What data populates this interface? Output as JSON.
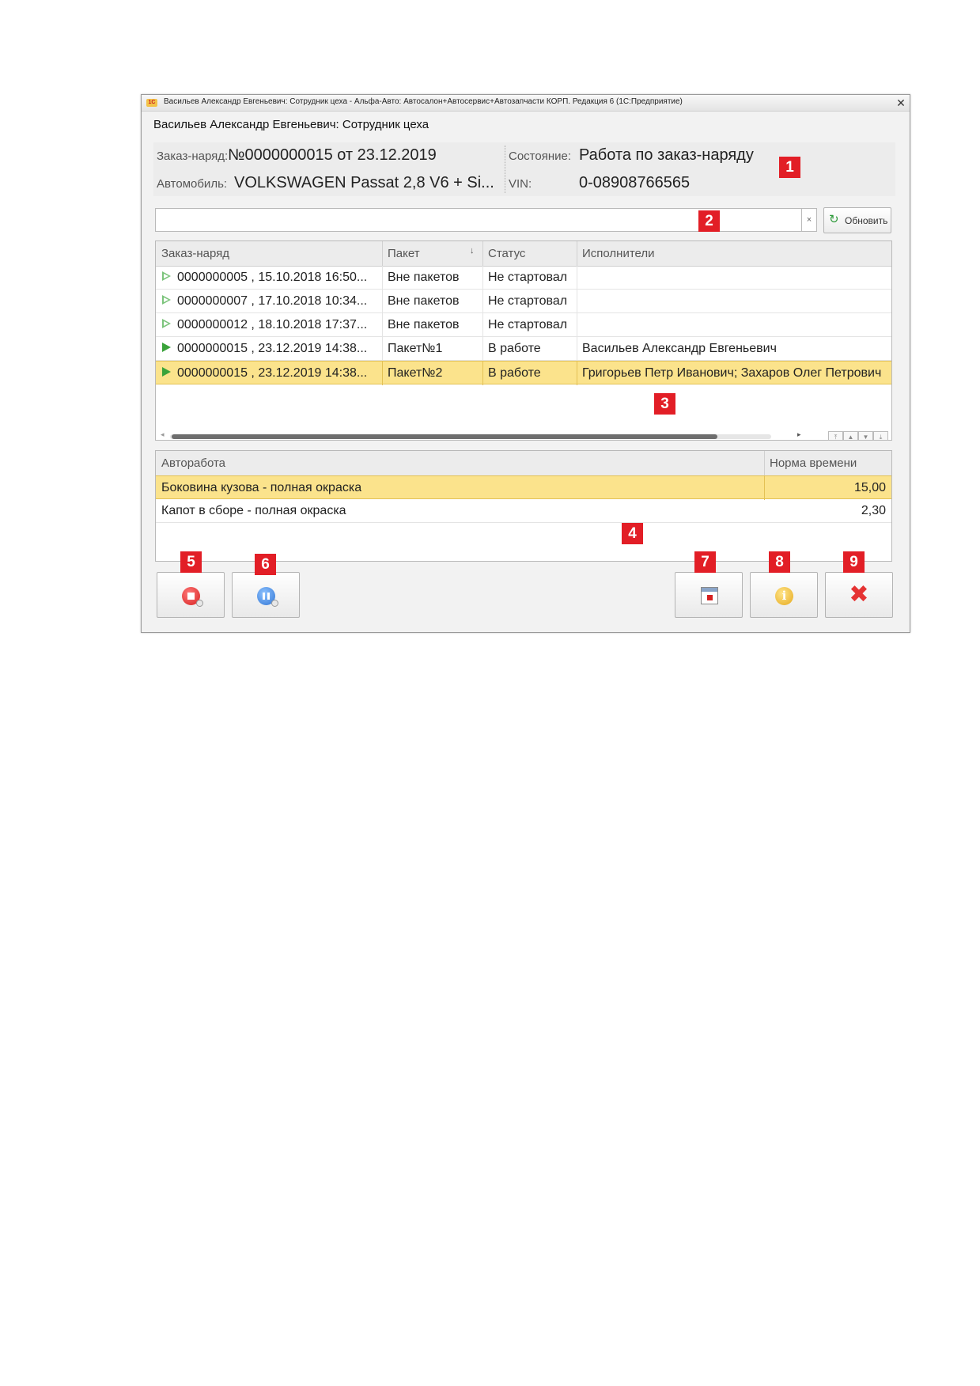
{
  "window": {
    "title": "Васильев Александр Евгеньевич: Сотрудник цеха - Альфа-Авто: Автосалон+Автосервис+Автозапчасти КОРП. Редакция 6 (1С:Предприятие)",
    "logo": "1С",
    "close_glyph": "✕"
  },
  "form_title": "Васильев Александр Евгеньевич: Сотрудник цеха",
  "header": {
    "order_label": "Заказ-наряд:",
    "order_value": "№0000000015  от 23.12.2019",
    "car_label": "Автомобиль:",
    "car_value": "VOLKSWAGEN Passat 2,8 V6 + Si...",
    "state_label": "Состояние:",
    "state_value": "Работа по заказ-наряду",
    "vin_label": "VIN:",
    "vin_value": "0-08908766565"
  },
  "search": {
    "value": "",
    "clear_glyph": "×",
    "refresh_icon": "↻",
    "refresh_label": "Обновить"
  },
  "orders_table": {
    "columns": [
      "Заказ-наряд",
      "Пакет",
      "Статус",
      "Исполнители"
    ],
    "sort_glyph": "↓",
    "rows": [
      {
        "order": "0000000005 , 15.10.2018 16:50...",
        "packet": "Вне пакетов",
        "status": "Не стартовал",
        "executors": "",
        "icon": "play-outline-icon"
      },
      {
        "order": "0000000007 , 17.10.2018 10:34...",
        "packet": "Вне пакетов",
        "status": "Не стартовал",
        "executors": "",
        "icon": "play-outline-icon"
      },
      {
        "order": "0000000012 , 18.10.2018 17:37...",
        "packet": "Вне пакетов",
        "status": "Не стартовал",
        "executors": "",
        "icon": "play-outline-icon"
      },
      {
        "order": "0000000015 , 23.12.2019 14:38...",
        "packet": "Пакет№1",
        "status": "В работе",
        "executors": "Васильев Александр Евгеньевич",
        "icon": "play-filled-icon"
      },
      {
        "order": "0000000015 , 23.12.2019 14:38...",
        "packet": "Пакет№2",
        "status": "В работе",
        "executors": "Григорьев Петр Иванович; Захаров Олег Петрович",
        "icon": "play-filled-icon"
      }
    ],
    "selected_row": 4,
    "scroll_left_glyph": "◂",
    "scroll_right_glyph": "▸",
    "nav_glyphs": [
      "⤒",
      "▲",
      "▼",
      "⤓"
    ]
  },
  "works_table": {
    "columns": [
      "Авторабота",
      "Норма времени"
    ],
    "rows": [
      {
        "work": "Боковина кузова - полная окраска",
        "norm": "15,00"
      },
      {
        "work": "Капот в сборе - полная окраска",
        "norm": "2,30"
      }
    ],
    "selected_row": 0
  },
  "buttons": {
    "stop_icon": "stop-circle-icon",
    "pause_icon": "pause-circle-icon",
    "calendar_icon": "calendar-icon",
    "info_icon": "info-icon",
    "info_glyph": "i",
    "close_icon": "close-icon",
    "close_glyph": "✖"
  },
  "badges": [
    "1",
    "2",
    "3",
    "4",
    "5",
    "6",
    "7",
    "8",
    "9"
  ],
  "colors": {
    "selection": "#fbe38c",
    "badge": "#e21e26",
    "refresh_icon": "#2e9a3a",
    "close_x": "#e53333"
  }
}
